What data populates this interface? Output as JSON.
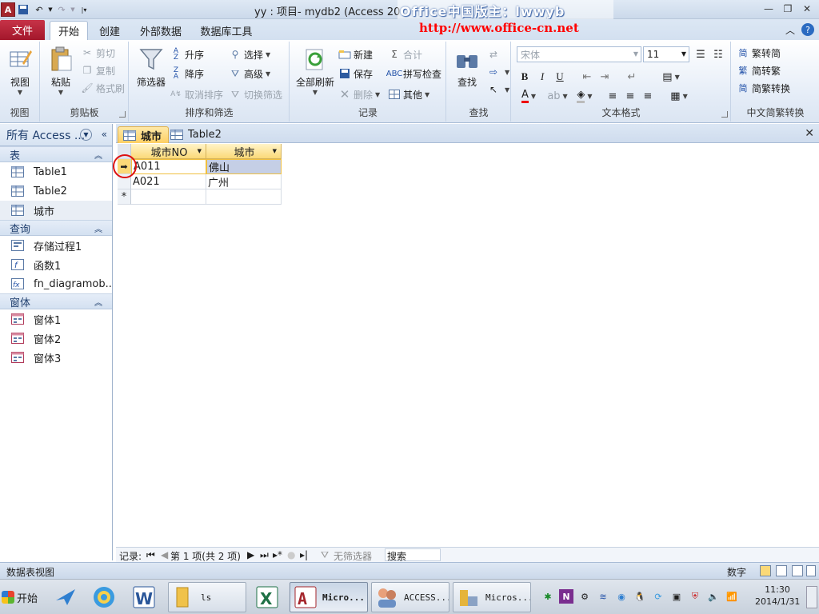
{
  "window": {
    "title": "yy : 项目- mydb2 (Access 20",
    "watermark_line1": "Office中国版主：lwwyb",
    "watermark_line2": "http://www.office-cn.net"
  },
  "ribbon_tabs": [
    "文件",
    "开始",
    "创建",
    "外部数据",
    "数据库工具"
  ],
  "ribbon": {
    "view": {
      "label": "视图",
      "group": "视图"
    },
    "clipboard": {
      "paste": "粘贴",
      "cut": "剪切",
      "copy": "复制",
      "format_painter": "格式刷",
      "group": "剪贴板"
    },
    "sort_filter": {
      "filter": "筛选器",
      "asc": "升序",
      "desc": "降序",
      "clear_sort": "取消排序",
      "select": "选择",
      "advanced": "高级",
      "toggle_filter": "切换筛选",
      "group": "排序和筛选"
    },
    "records": {
      "refresh_all": "全部刷新",
      "new": "新建",
      "save": "保存",
      "delete": "删除",
      "totals": "合计",
      "spelling": "拼写检查",
      "more": "其他",
      "group": "记录"
    },
    "find": {
      "find": "查找",
      "group": "查找"
    },
    "text_format": {
      "font": "宋体",
      "size": "11",
      "group": "文本格式"
    },
    "chinese": {
      "t2s": "繁转简",
      "s2t": "简转繁",
      "convert": "简繁转换",
      "group": "中文简繁转换"
    }
  },
  "nav_pane": {
    "header": "所有 Access ...",
    "sections": [
      {
        "title": "表",
        "items": [
          "Table1",
          "Table2",
          "城市"
        ]
      },
      {
        "title": "查询",
        "items": [
          "存储过程1",
          "函数1",
          "fn_diagramob..."
        ]
      },
      {
        "title": "窗体",
        "items": [
          "窗体1",
          "窗体2",
          "窗体3"
        ]
      }
    ]
  },
  "doc_tabs": [
    "城市",
    "Table2"
  ],
  "datasheet": {
    "columns": [
      "城市NO",
      "城市"
    ],
    "rows": [
      [
        "A011",
        "佛山"
      ],
      [
        "A021",
        "广州"
      ]
    ],
    "new_row_marker": "*",
    "current_marker": "➡"
  },
  "record_nav": {
    "label": "记录:",
    "position": "第 1 项(共 2 项)",
    "filter": "无筛选器",
    "search": "搜索"
  },
  "status": {
    "left": "数据表视图",
    "numlock": "数字"
  },
  "taskbar": {
    "start": "开始",
    "buttons": [
      "ls",
      "Micro...",
      "ACCESS...",
      "Micros..."
    ],
    "time": "11:30",
    "date": "2014/1/31"
  }
}
